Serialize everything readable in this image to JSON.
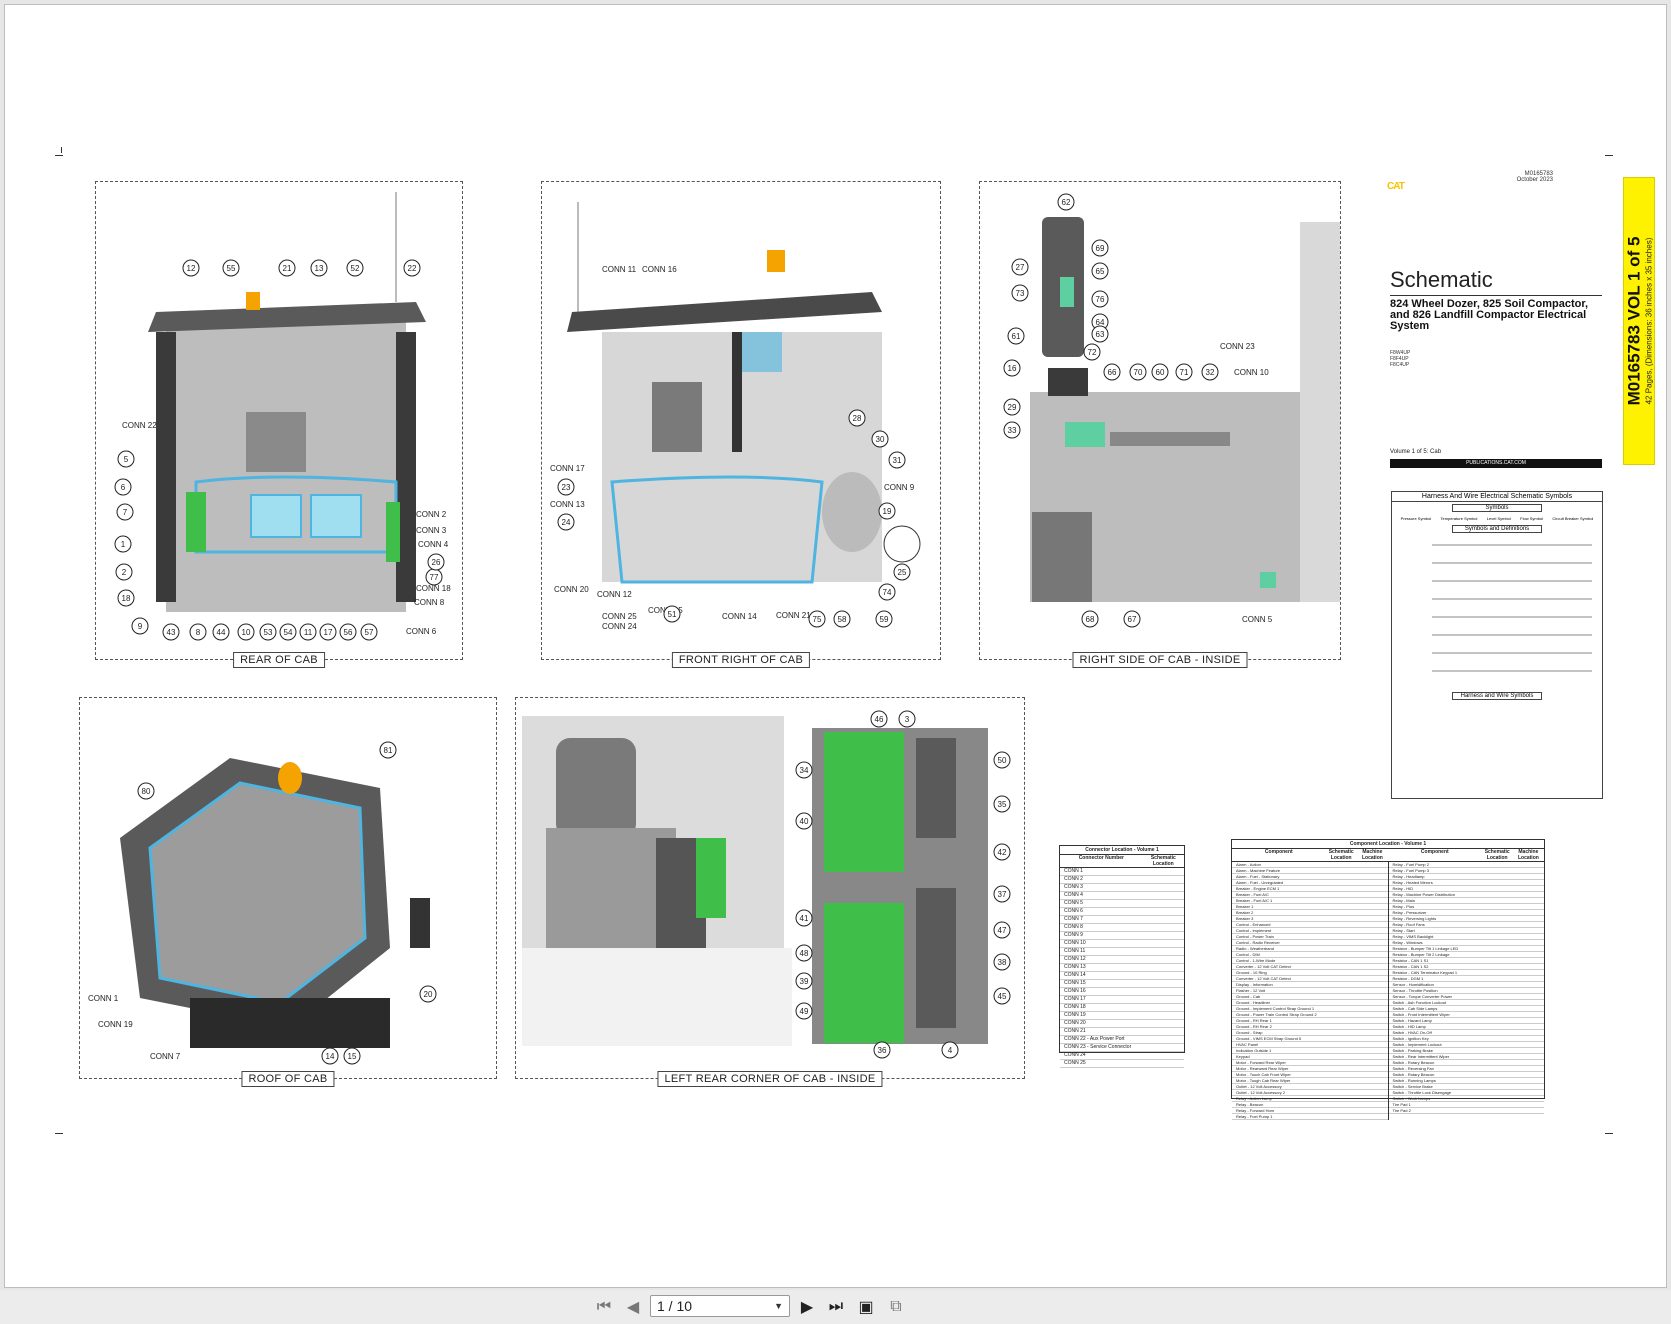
{
  "views": {
    "rear_of_cab": "REAR OF CAB",
    "front_right_of_cab": "FRONT RIGHT OF CAB",
    "right_side_inside": "RIGHT SIDE OF CAB - INSIDE",
    "roof_of_cab": "ROOF OF CAB",
    "left_rear_inside": "LEFT REAR CORNER OF CAB - INSIDE"
  },
  "callouts": {
    "rear": [
      "12",
      "55",
      "21",
      "13",
      "52",
      "22",
      "CONN 22",
      "5",
      "6",
      "7",
      "1",
      "2",
      "18",
      "9",
      "43",
      "8",
      "44",
      "10",
      "53",
      "54",
      "11",
      "17",
      "56",
      "57",
      "CONN 6",
      "CONN 8",
      "CONN 18",
      "77",
      "26",
      "CONN 4",
      "CONN 3",
      "CONN 2"
    ],
    "front_right": [
      "CONN 11",
      "CONN 16",
      "CONN 17",
      "23",
      "CONN 13",
      "24",
      "CONN 20",
      "CONN 12",
      "CONN 25",
      "CONN 24",
      "CONN 15",
      "51",
      "CONN 14",
      "CONN 21",
      "75",
      "58",
      "59",
      "74",
      "25",
      "19",
      "CONN 9",
      "31",
      "30",
      "28"
    ],
    "right_inside": [
      "62",
      "69",
      "27",
      "65",
      "73",
      "76",
      "64",
      "61",
      "63",
      "72",
      "16",
      "66",
      "70",
      "60",
      "71",
      "32",
      "CONN 23",
      "CONN 10",
      "29",
      "33",
      "68",
      "67",
      "CONN 5"
    ],
    "roof": [
      "80",
      "81",
      "CONN 1",
      "CONN 19",
      "CONN 7",
      "14",
      "15",
      "20"
    ],
    "left_rear": [
      "46",
      "3",
      "34",
      "50",
      "35",
      "40",
      "42",
      "37",
      "41",
      "47",
      "48",
      "38",
      "39",
      "45",
      "49",
      "36",
      "4"
    ]
  },
  "title_block": {
    "brand": "CAT",
    "doc_number": "M0165783",
    "date": "October 2023",
    "title": "Schematic",
    "subtitle": "824 Wheel Dozer, 825 Soil Compactor, and 826 Landfill Compactor Electrical System",
    "serials": [
      "F8W4UP",
      "F8F4UP",
      "F8C4UP"
    ],
    "volume": "Volume 1 of 5: Cab",
    "publications": "PUBLICATIONS.CAT.COM",
    "tab_main": "M0165783 VOL 1 of 5",
    "tab_sub": "42 Pages, (Dimensions: 36 inches x 35 inches)"
  },
  "symbols_box": {
    "header": "Harness And Wire Electrical Schematic Symbols",
    "symbols_label": "Symbols",
    "symbol_names": [
      "Pressure Symbol",
      "Temperature Symbol",
      "Level Symbol",
      "Flow Symbol",
      "Circuit Breaker Symbol"
    ],
    "definitions_label": "Symbols and Definitions",
    "harness_label": "Harness and Wire Symbols"
  },
  "connector_table": {
    "title": "Connector Location - Volume 1",
    "col1": "Connector Number",
    "col2": "Schematic Location",
    "rows": [
      "CONN 1",
      "CONN 2",
      "CONN 3",
      "CONN 4",
      "CONN 5",
      "CONN 6",
      "CONN 7",
      "CONN 8",
      "CONN 9",
      "CONN 10",
      "CONN 11",
      "CONN 12",
      "CONN 13",
      "CONN 14",
      "CONN 15",
      "CONN 16",
      "CONN 17",
      "CONN 18",
      "CONN 19",
      "CONN 20",
      "CONN 21",
      "CONN 22 - Aux Power Port",
      "CONN 23 - Service Connector",
      "CONN 24",
      "CONN 25"
    ]
  },
  "component_table": {
    "title": "Component Location - Volume 1",
    "col_component": "Component",
    "col_schematic": "Schematic Location",
    "col_machine": "Machine Location",
    "left_rows": [
      "Alarm - Action",
      "Alarm - Machine Feature",
      "Alarm - Fuel - Stationary",
      "Alarm - Fuel - Unregulated",
      "Breaker - Engine ECM 1",
      "Breaker - Fuel A/C",
      "Breaker - Fuel A/C 1",
      "Breaker 1",
      "Breaker 2",
      "Breaker 3",
      "Control - Enhanced",
      "Control - Implement",
      "Control - Power Train",
      "Control - Radio Receiver",
      "Radio - Weatherband",
      "Control - DIM",
      "Control - 1-Wire Mode",
      "Converter - 12 Volt CAT Detect",
      "Ground - 10 Ring",
      "Converter - 12 Volt CAT Detect",
      "Display - Information",
      "Flasher - 12 Volt",
      "Ground - Cab",
      "Ground - Headliner",
      "Ground - Implement Control Strap Ground 1",
      "Ground - Power Train Control Strap Ground 2",
      "Ground - RH Rear 1",
      "Ground - RH Rear 2",
      "Ground - Strap",
      "Ground - VIMS ECM Strap Ground 5",
      "HVAC Panel",
      "Indication Outside 1",
      "Keypad",
      "Motor - Forward Rear Wiper",
      "Motor - Rearward Rear Wiper",
      "Motor - Touch Cab Front Wiper",
      "Motor - Tough Cab Rear Wiper",
      "Outlet - 12 Volt Accessory",
      "Outlet - 12 Volt Accessory 2",
      "Relay - Action Lamp",
      "Relay - Beacon",
      "Relay - Forward Horn",
      "Relay - Fuel Pump 1"
    ],
    "right_rows": [
      "Relay - Fuel Pump 2",
      "Relay - Fuel Pump 3",
      "Relay - Headlamp",
      "Relay - Heated Mirrors",
      "Relay - HID",
      "Relay - Machine Power Distribution",
      "Relay - Main",
      "Relay - Plus",
      "Relay - Pressurizer",
      "Relay - Reversing Lights",
      "Relay - Roof Fans",
      "Relay - Start",
      "Relay - VIMS Backlight",
      "Relay - Windows",
      "Resistor - Bumper Tilt 1 Linkage LED",
      "Resistor - Bumper Tilt 2 Linkage",
      "Resistor - CAN 1 S1",
      "Resistor - CAN 1 S2",
      "Resistor - CAN Terminator Keypad 1",
      "Resistor - DGM 1",
      "Sensor - Humidification",
      "Sensor - Throttle Position",
      "Sensor - Torque Converter Power",
      "Switch - Ash Function Lockout",
      "Switch - Cab Side Lamps",
      "Switch - Front Intermittent Wiper",
      "Switch - Hazard Lamp",
      "Switch - HID Lamp",
      "Switch - HVAC On-Off",
      "Switch - Ignition Key",
      "Switch - Implement Lockout",
      "Switch - Parking Brake",
      "Switch - Rear Intermittent Wiper",
      "Switch - Rotary Beacon",
      "Switch - Reversing Fan",
      "Switch - Rotary Beacon",
      "Switch - Running Lamps",
      "Switch - Service Brake",
      "Switch - Throttle Lock Disengage",
      "Switch - Work Lamps",
      "Tire Pad 1",
      "Tire Pad 2"
    ]
  },
  "toolbar": {
    "page_value": "1 / 10"
  },
  "colors": {
    "accent_yellow": "#fff200",
    "harness_blue": "#4fb4e0",
    "connector_green": "#5ecfa0",
    "fuse_panel_green": "#3fbf4a",
    "beacon_orange": "#f5a300"
  }
}
